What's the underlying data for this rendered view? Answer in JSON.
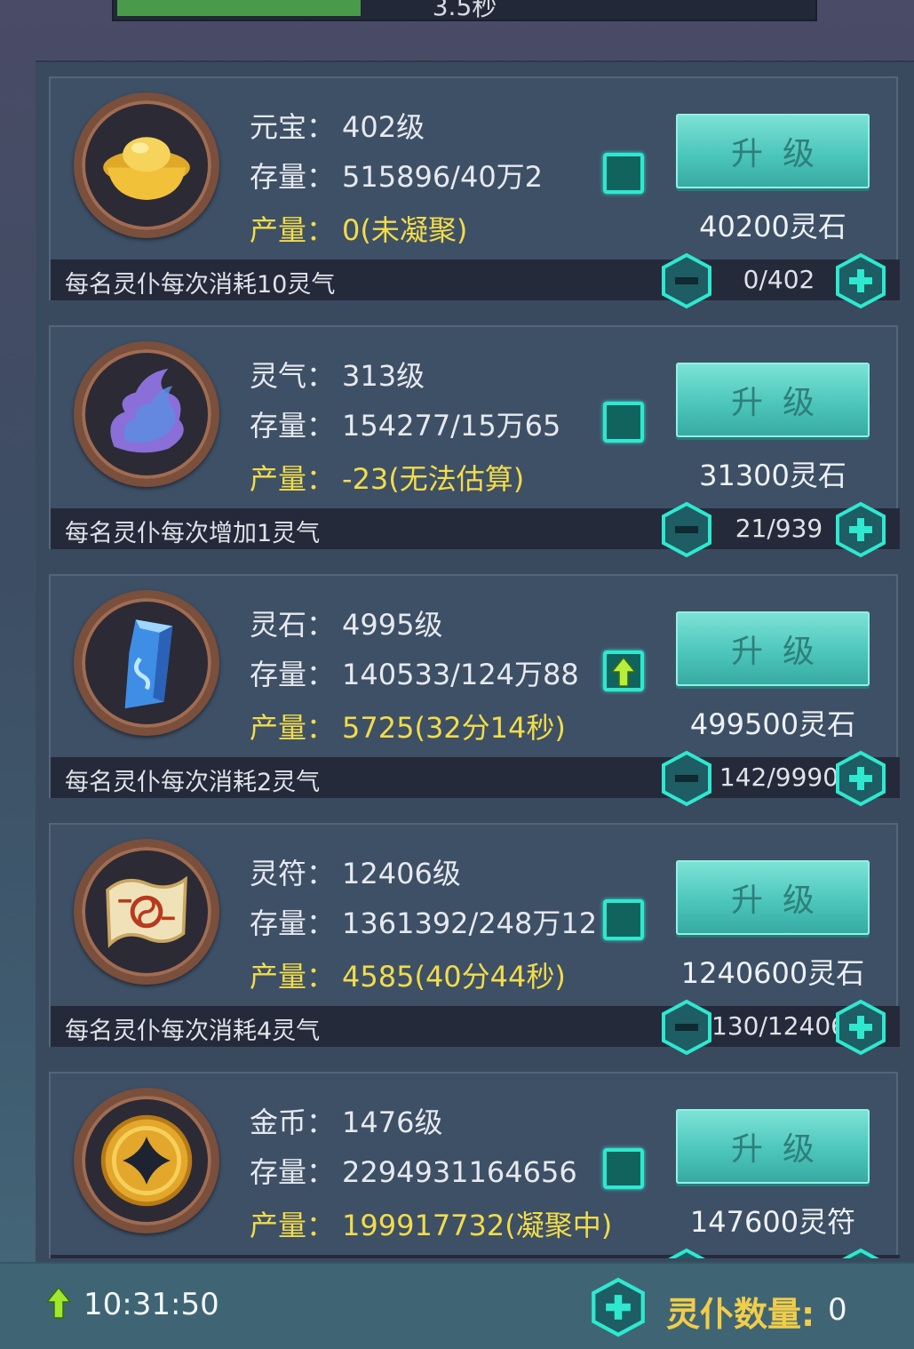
{
  "top_timer": {
    "text": "3.5秒",
    "progress": 0.35
  },
  "items": [
    {
      "icon": "gold-ingot-icon",
      "name_label": "元宝：",
      "level": "402级",
      "stock_label": "存量：",
      "stock": "515896/40万2",
      "output_label": "产量：",
      "output": "0(未凝聚)",
      "toggle": "checkbox",
      "upgrade_label": "升级",
      "cost": "40200灵石",
      "desc": "每名灵仆每次消耗10灵气",
      "count": "0/402"
    },
    {
      "icon": "spirit-flame-icon",
      "name_label": "灵气：",
      "level": "313级",
      "stock_label": "存量：",
      "stock": "154277/15万65",
      "output_label": "产量：",
      "output": "-23(无法估算)",
      "toggle": "checkbox",
      "upgrade_label": "升级",
      "cost": "31300灵石",
      "desc": "每名灵仆每次增加1灵气",
      "count": "21/939"
    },
    {
      "icon": "spirit-stone-icon",
      "name_label": "灵石：",
      "level": "4995级",
      "stock_label": "存量：",
      "stock": "140533/124万88",
      "output_label": "产量：",
      "output": "5725(32分14秒)",
      "toggle": "upgrade-arrow",
      "upgrade_label": "升级",
      "cost": "499500灵石",
      "desc": "每名灵仆每次消耗2灵气",
      "count": "142/9990"
    },
    {
      "icon": "talisman-scroll-icon",
      "name_label": "灵符：",
      "level": "12406级",
      "stock_label": "存量：",
      "stock": "1361392/248万12",
      "output_label": "产量：",
      "output": "4585(40分44秒)",
      "toggle": "checkbox",
      "upgrade_label": "升级",
      "cost": "1240600灵石",
      "desc": "每名灵仆每次消耗4灵气",
      "count": "130/12406"
    },
    {
      "icon": "gold-coin-icon",
      "name_label": "金币：",
      "level": "1476级",
      "stock_label": "存量：",
      "stock": "2294931164656",
      "output_label": "产量：",
      "output": "199917732(凝聚中)",
      "toggle": "checkbox",
      "upgrade_label": "升级",
      "cost": "147600灵符",
      "desc": "",
      "count": ""
    }
  ],
  "footer": {
    "time": "10:31:50",
    "servant_label": "灵仆数量:",
    "servant_count": "0"
  },
  "colors": {
    "accent": "#2ee8cf",
    "output_text": "#f2dc4a",
    "button": "#4cc6bb",
    "footer_label": "#f1cd49"
  }
}
